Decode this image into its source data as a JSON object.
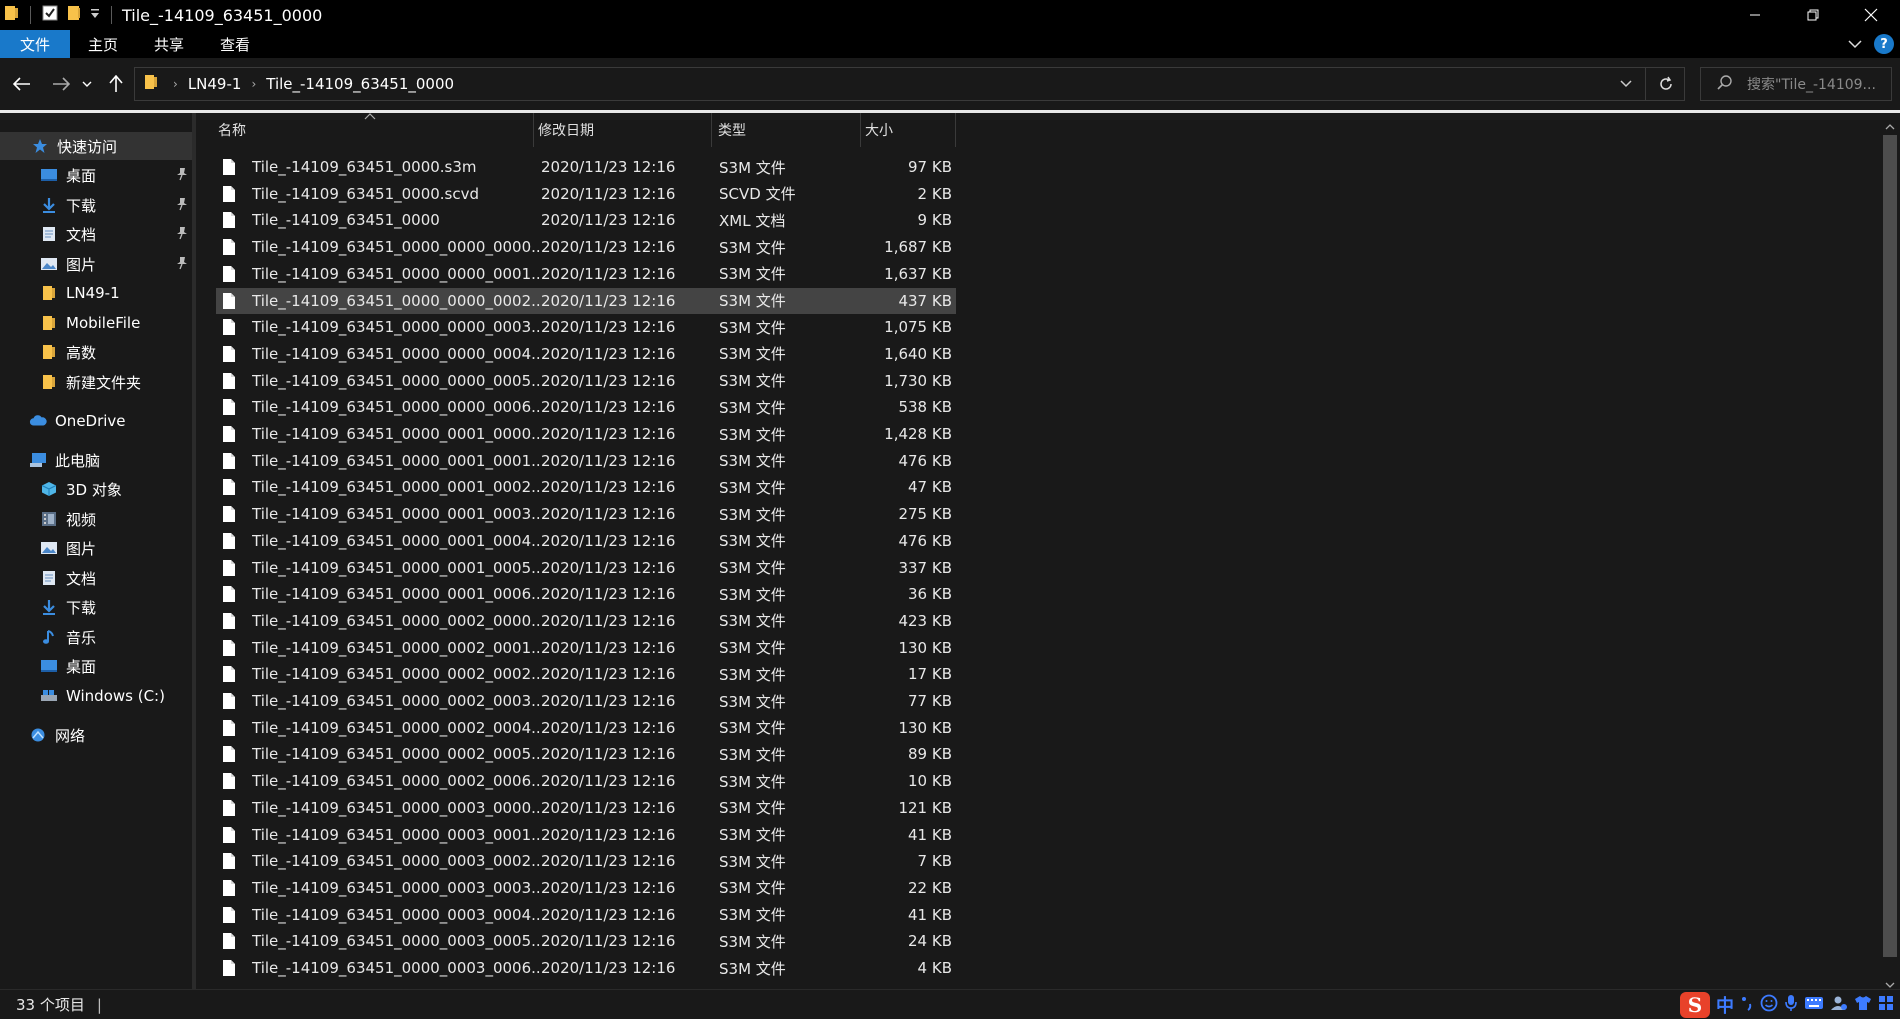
{
  "window": {
    "title": "Tile_-14109_63451_0000"
  },
  "ribbon": {
    "tabs": [
      {
        "label": "文件"
      },
      {
        "label": "主页"
      },
      {
        "label": "共享"
      },
      {
        "label": "查看"
      }
    ]
  },
  "address": {
    "crumbs": [
      "LN49-1",
      "Tile_-14109_63451_0000"
    ],
    "search_placeholder": "搜索\"Tile_-14109..."
  },
  "nav": {
    "quick_access": "快速访问",
    "items": [
      {
        "label": "桌面",
        "icon": "desktop-icon",
        "pinned": true
      },
      {
        "label": "下载",
        "icon": "download-icon",
        "pinned": true
      },
      {
        "label": "文档",
        "icon": "document-icon",
        "pinned": true
      },
      {
        "label": "图片",
        "icon": "picture-icon",
        "pinned": true
      },
      {
        "label": "LN49-1",
        "icon": "folder-icon",
        "pinned": false
      },
      {
        "label": "MobileFile",
        "icon": "folder-icon",
        "pinned": false
      },
      {
        "label": "高数",
        "icon": "folder-icon",
        "pinned": false
      },
      {
        "label": "新建文件夹",
        "icon": "folder-icon",
        "pinned": false
      }
    ],
    "onedrive": "OneDrive",
    "this_pc": "此电脑",
    "pc_items": [
      {
        "label": "3D 对象",
        "icon": "3d-objects-icon"
      },
      {
        "label": "视频",
        "icon": "video-icon"
      },
      {
        "label": "图片",
        "icon": "picture-icon"
      },
      {
        "label": "文档",
        "icon": "document-icon"
      },
      {
        "label": "下载",
        "icon": "download-icon"
      },
      {
        "label": "音乐",
        "icon": "music-icon"
      },
      {
        "label": "桌面",
        "icon": "desktop-icon"
      },
      {
        "label": "Windows (C:)",
        "icon": "drive-icon"
      }
    ],
    "network": "网络"
  },
  "columns": {
    "name": "名称",
    "date": "修改日期",
    "type": "类型",
    "size": "大小"
  },
  "files": [
    {
      "name": "Tile_-14109_63451_0000.s3m",
      "date": "2020/11/23 12:16",
      "type": "S3M 文件",
      "size": "97 KB"
    },
    {
      "name": "Tile_-14109_63451_0000.scvd",
      "date": "2020/11/23 12:16",
      "type": "SCVD 文件",
      "size": "2 KB"
    },
    {
      "name": "Tile_-14109_63451_0000",
      "date": "2020/11/23 12:16",
      "type": "XML 文档",
      "size": "9 KB"
    },
    {
      "name": "Tile_-14109_63451_0000_0000_0000....",
      "date": "2020/11/23 12:16",
      "type": "S3M 文件",
      "size": "1,687 KB"
    },
    {
      "name": "Tile_-14109_63451_0000_0000_0001....",
      "date": "2020/11/23 12:16",
      "type": "S3M 文件",
      "size": "1,637 KB"
    },
    {
      "name": "Tile_-14109_63451_0000_0000_0002....",
      "date": "2020/11/23 12:16",
      "type": "S3M 文件",
      "size": "437 KB",
      "selected": true
    },
    {
      "name": "Tile_-14109_63451_0000_0000_0003....",
      "date": "2020/11/23 12:16",
      "type": "S3M 文件",
      "size": "1,075 KB"
    },
    {
      "name": "Tile_-14109_63451_0000_0000_0004....",
      "date": "2020/11/23 12:16",
      "type": "S3M 文件",
      "size": "1,640 KB"
    },
    {
      "name": "Tile_-14109_63451_0000_0000_0005....",
      "date": "2020/11/23 12:16",
      "type": "S3M 文件",
      "size": "1,730 KB"
    },
    {
      "name": "Tile_-14109_63451_0000_0000_0006....",
      "date": "2020/11/23 12:16",
      "type": "S3M 文件",
      "size": "538 KB"
    },
    {
      "name": "Tile_-14109_63451_0000_0001_0000....",
      "date": "2020/11/23 12:16",
      "type": "S3M 文件",
      "size": "1,428 KB"
    },
    {
      "name": "Tile_-14109_63451_0000_0001_0001....",
      "date": "2020/11/23 12:16",
      "type": "S3M 文件",
      "size": "476 KB"
    },
    {
      "name": "Tile_-14109_63451_0000_0001_0002....",
      "date": "2020/11/23 12:16",
      "type": "S3M 文件",
      "size": "47 KB"
    },
    {
      "name": "Tile_-14109_63451_0000_0001_0003....",
      "date": "2020/11/23 12:16",
      "type": "S3M 文件",
      "size": "275 KB"
    },
    {
      "name": "Tile_-14109_63451_0000_0001_0004....",
      "date": "2020/11/23 12:16",
      "type": "S3M 文件",
      "size": "476 KB"
    },
    {
      "name": "Tile_-14109_63451_0000_0001_0005....",
      "date": "2020/11/23 12:16",
      "type": "S3M 文件",
      "size": "337 KB"
    },
    {
      "name": "Tile_-14109_63451_0000_0001_0006....",
      "date": "2020/11/23 12:16",
      "type": "S3M 文件",
      "size": "36 KB"
    },
    {
      "name": "Tile_-14109_63451_0000_0002_0000....",
      "date": "2020/11/23 12:16",
      "type": "S3M 文件",
      "size": "423 KB"
    },
    {
      "name": "Tile_-14109_63451_0000_0002_0001....",
      "date": "2020/11/23 12:16",
      "type": "S3M 文件",
      "size": "130 KB"
    },
    {
      "name": "Tile_-14109_63451_0000_0002_0002....",
      "date": "2020/11/23 12:16",
      "type": "S3M 文件",
      "size": "17 KB"
    },
    {
      "name": "Tile_-14109_63451_0000_0002_0003....",
      "date": "2020/11/23 12:16",
      "type": "S3M 文件",
      "size": "77 KB"
    },
    {
      "name": "Tile_-14109_63451_0000_0002_0004....",
      "date": "2020/11/23 12:16",
      "type": "S3M 文件",
      "size": "130 KB"
    },
    {
      "name": "Tile_-14109_63451_0000_0002_0005....",
      "date": "2020/11/23 12:16",
      "type": "S3M 文件",
      "size": "89 KB"
    },
    {
      "name": "Tile_-14109_63451_0000_0002_0006....",
      "date": "2020/11/23 12:16",
      "type": "S3M 文件",
      "size": "10 KB"
    },
    {
      "name": "Tile_-14109_63451_0000_0003_0000....",
      "date": "2020/11/23 12:16",
      "type": "S3M 文件",
      "size": "121 KB"
    },
    {
      "name": "Tile_-14109_63451_0000_0003_0001....",
      "date": "2020/11/23 12:16",
      "type": "S3M 文件",
      "size": "41 KB"
    },
    {
      "name": "Tile_-14109_63451_0000_0003_0002....",
      "date": "2020/11/23 12:16",
      "type": "S3M 文件",
      "size": "7 KB"
    },
    {
      "name": "Tile_-14109_63451_0000_0003_0003....",
      "date": "2020/11/23 12:16",
      "type": "S3M 文件",
      "size": "22 KB"
    },
    {
      "name": "Tile_-14109_63451_0000_0003_0004....",
      "date": "2020/11/23 12:16",
      "type": "S3M 文件",
      "size": "41 KB"
    },
    {
      "name": "Tile_-14109_63451_0000_0003_0005....",
      "date": "2020/11/23 12:16",
      "type": "S3M 文件",
      "size": "24 KB"
    },
    {
      "name": "Tile_-14109_63451_0000_0003_0006....",
      "date": "2020/11/23 12:16",
      "type": "S3M 文件",
      "size": "4 KB"
    }
  ],
  "status": {
    "count": "33 个项目",
    "ime_label": "中"
  },
  "colors": {
    "accent": "#1979ca",
    "folder": "#f8c24a",
    "selected_row": "#444444",
    "background": "#191919"
  }
}
